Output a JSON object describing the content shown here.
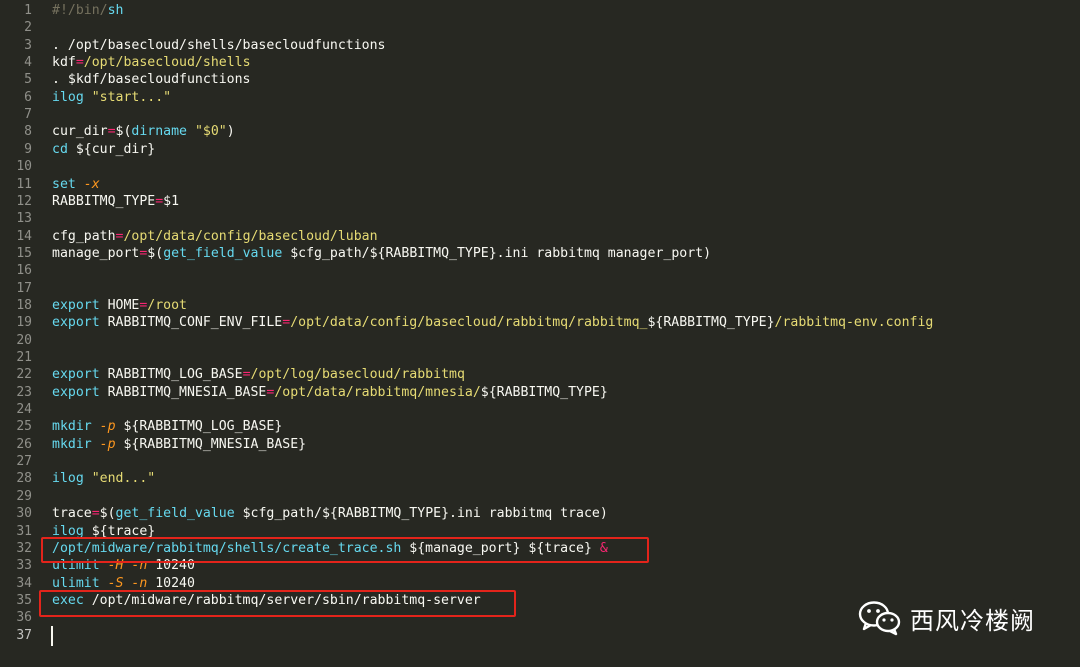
{
  "editor": {
    "lines": [
      {
        "n": "1",
        "tokens": [
          {
            "t": "#!/bin/",
            "c": "t-com"
          },
          {
            "t": "sh",
            "c": "t-kw"
          }
        ]
      },
      {
        "n": "2",
        "tokens": []
      },
      {
        "n": "3",
        "tokens": [
          {
            "t": ". /opt/basecloud/shells/basecloudfunctions",
            "c": "t-var"
          }
        ]
      },
      {
        "n": "4",
        "tokens": [
          {
            "t": "kdf",
            "c": "t-var"
          },
          {
            "t": "=",
            "c": "t-op"
          },
          {
            "t": "/opt/basecloud/shells",
            "c": "t-str"
          }
        ]
      },
      {
        "n": "5",
        "tokens": [
          {
            "t": ". $kdf/basecloudfunctions",
            "c": "t-var"
          }
        ]
      },
      {
        "n": "6",
        "tokens": [
          {
            "t": "ilog ",
            "c": "t-kw"
          },
          {
            "t": "\"start...\"",
            "c": "t-str"
          }
        ]
      },
      {
        "n": "7",
        "tokens": []
      },
      {
        "n": "8",
        "tokens": [
          {
            "t": "cur_dir",
            "c": "t-var"
          },
          {
            "t": "=",
            "c": "t-op"
          },
          {
            "t": "$(",
            "c": "t-var"
          },
          {
            "t": "dirname",
            "c": "t-fn"
          },
          {
            "t": " ",
            "c": "t-var"
          },
          {
            "t": "\"$0\"",
            "c": "t-str"
          },
          {
            "t": ")",
            "c": "t-var"
          }
        ]
      },
      {
        "n": "9",
        "tokens": [
          {
            "t": "cd",
            "c": "t-kw"
          },
          {
            "t": " ${cur_dir}",
            "c": "t-var"
          }
        ]
      },
      {
        "n": "10",
        "tokens": []
      },
      {
        "n": "11",
        "tokens": [
          {
            "t": "set ",
            "c": "t-kw"
          },
          {
            "t": "-x",
            "c": "t-it"
          }
        ]
      },
      {
        "n": "12",
        "tokens": [
          {
            "t": "RABBITMQ_TYPE",
            "c": "t-var"
          },
          {
            "t": "=",
            "c": "t-op"
          },
          {
            "t": "$1",
            "c": "t-var"
          }
        ]
      },
      {
        "n": "13",
        "tokens": []
      },
      {
        "n": "14",
        "tokens": [
          {
            "t": "cfg_path",
            "c": "t-var"
          },
          {
            "t": "=",
            "c": "t-op"
          },
          {
            "t": "/opt/data/config/basecloud/luban",
            "c": "t-str"
          }
        ]
      },
      {
        "n": "15",
        "tokens": [
          {
            "t": "manage_port",
            "c": "t-var"
          },
          {
            "t": "=",
            "c": "t-op"
          },
          {
            "t": "$(",
            "c": "t-var"
          },
          {
            "t": "get_field_value",
            "c": "t-fn"
          },
          {
            "t": " $cfg_path/${RABBITMQ_TYPE}.ini rabbitmq manager_port)",
            "c": "t-var"
          }
        ]
      },
      {
        "n": "16",
        "tokens": []
      },
      {
        "n": "17",
        "tokens": []
      },
      {
        "n": "18",
        "tokens": [
          {
            "t": "export ",
            "c": "t-kw"
          },
          {
            "t": "HOME",
            "c": "t-var"
          },
          {
            "t": "=",
            "c": "t-op"
          },
          {
            "t": "/root",
            "c": "t-str"
          }
        ]
      },
      {
        "n": "19",
        "tokens": [
          {
            "t": "export ",
            "c": "t-kw"
          },
          {
            "t": "RABBITMQ_CONF_ENV_FILE",
            "c": "t-var"
          },
          {
            "t": "=",
            "c": "t-op"
          },
          {
            "t": "/opt/data/config/basecloud/rabbitmq/rabbitmq_",
            "c": "t-str"
          },
          {
            "t": "${RABBITMQ_TYPE}",
            "c": "t-var"
          },
          {
            "t": "/rabbitmq-env.config",
            "c": "t-str"
          }
        ]
      },
      {
        "n": "20",
        "tokens": []
      },
      {
        "n": "21",
        "tokens": []
      },
      {
        "n": "22",
        "tokens": [
          {
            "t": "export ",
            "c": "t-kw"
          },
          {
            "t": "RABBITMQ_LOG_BASE",
            "c": "t-var"
          },
          {
            "t": "=",
            "c": "t-op"
          },
          {
            "t": "/opt/log/basecloud/rabbitmq",
            "c": "t-str"
          }
        ]
      },
      {
        "n": "23",
        "tokens": [
          {
            "t": "export ",
            "c": "t-kw"
          },
          {
            "t": "RABBITMQ_MNESIA_BASE",
            "c": "t-var"
          },
          {
            "t": "=",
            "c": "t-op"
          },
          {
            "t": "/opt/data/rabbitmq/mnesia/",
            "c": "t-str"
          },
          {
            "t": "${RABBITMQ_TYPE}",
            "c": "t-var"
          }
        ]
      },
      {
        "n": "24",
        "tokens": []
      },
      {
        "n": "25",
        "tokens": [
          {
            "t": "mkdir ",
            "c": "t-kw"
          },
          {
            "t": "-p",
            "c": "t-it"
          },
          {
            "t": " ${RABBITMQ_LOG_BASE}",
            "c": "t-var"
          }
        ]
      },
      {
        "n": "26",
        "tokens": [
          {
            "t": "mkdir ",
            "c": "t-kw"
          },
          {
            "t": "-p",
            "c": "t-it"
          },
          {
            "t": " ${RABBITMQ_MNESIA_BASE}",
            "c": "t-var"
          }
        ]
      },
      {
        "n": "27",
        "tokens": []
      },
      {
        "n": "28",
        "tokens": [
          {
            "t": "ilog ",
            "c": "t-kw"
          },
          {
            "t": "\"end...\"",
            "c": "t-str"
          }
        ]
      },
      {
        "n": "29",
        "tokens": []
      },
      {
        "n": "30",
        "tokens": [
          {
            "t": "trace",
            "c": "t-var"
          },
          {
            "t": "=",
            "c": "t-op"
          },
          {
            "t": "$(",
            "c": "t-var"
          },
          {
            "t": "get_field_value",
            "c": "t-fn"
          },
          {
            "t": " $cfg_path/${RABBITMQ_TYPE}.ini rabbitmq trace)",
            "c": "t-var"
          }
        ]
      },
      {
        "n": "31",
        "tokens": [
          {
            "t": "ilog ",
            "c": "t-kw"
          },
          {
            "t": "${trace}",
            "c": "t-var"
          }
        ]
      },
      {
        "n": "32",
        "tokens": [
          {
            "t": "/opt/midware/rabbitmq/shells/create_trace.sh",
            "c": "t-fn"
          },
          {
            "t": " ${manage_port} ${trace} ",
            "c": "t-var"
          },
          {
            "t": "&",
            "c": "t-op"
          }
        ]
      },
      {
        "n": "33",
        "tokens": [
          {
            "t": "ulimit ",
            "c": "t-kw"
          },
          {
            "t": "-H -n",
            "c": "t-it"
          },
          {
            "t": " 10240",
            "c": "t-var"
          }
        ]
      },
      {
        "n": "34",
        "tokens": [
          {
            "t": "ulimit ",
            "c": "t-kw"
          },
          {
            "t": "-S -n",
            "c": "t-it"
          },
          {
            "t": " 10240",
            "c": "t-var"
          }
        ]
      },
      {
        "n": "35",
        "tokens": [
          {
            "t": "exec ",
            "c": "t-kw"
          },
          {
            "t": "/opt/midware/rabbitmq/server/sbin/rabbitmq-server",
            "c": "t-var"
          }
        ]
      },
      {
        "n": "36",
        "tokens": []
      },
      {
        "n": "37",
        "tokens": []
      }
    ],
    "active_line": "37",
    "highlight_lines": [
      "32",
      "35"
    ]
  },
  "watermark": {
    "icon": "wechat-icon",
    "text": "西风冷楼阙"
  },
  "colors": {
    "background": "#272822",
    "highlight_box": "#e3241b"
  }
}
